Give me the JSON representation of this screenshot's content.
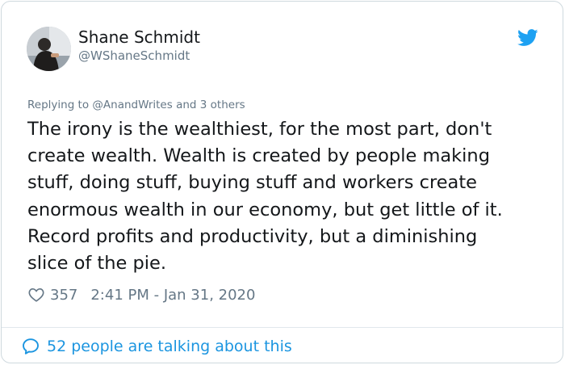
{
  "author": {
    "name": "Shane Schmidt",
    "handle": "@WShaneSchmidt"
  },
  "reply_context": {
    "prefix": "Replying to",
    "mention": "@AnandWrites",
    "suffix": "and 3 others"
  },
  "tweet": {
    "text": "The irony is the wealthiest, for the most part, don't\ncreate wealth.  Wealth is created by people making\nstuff, doing stuff, buying stuff and workers create\nenormous wealth in our economy, but get little of it.\nRecord profits and productivity, but a diminishing\nslice of the pie."
  },
  "meta": {
    "likes": "357",
    "timestamp": "2:41 PM - Jan 31, 2020"
  },
  "footer": {
    "talking": "52 people are talking about this"
  },
  "icons": {
    "brand": "twitter-bird-icon",
    "like": "heart-icon",
    "reply": "speech-bubble-icon"
  },
  "colors": {
    "twitter_blue": "#1da1f2",
    "link_blue": "#1b95e0",
    "muted_text": "#657786",
    "body_text": "#14171a",
    "border": "#cfd9de"
  }
}
